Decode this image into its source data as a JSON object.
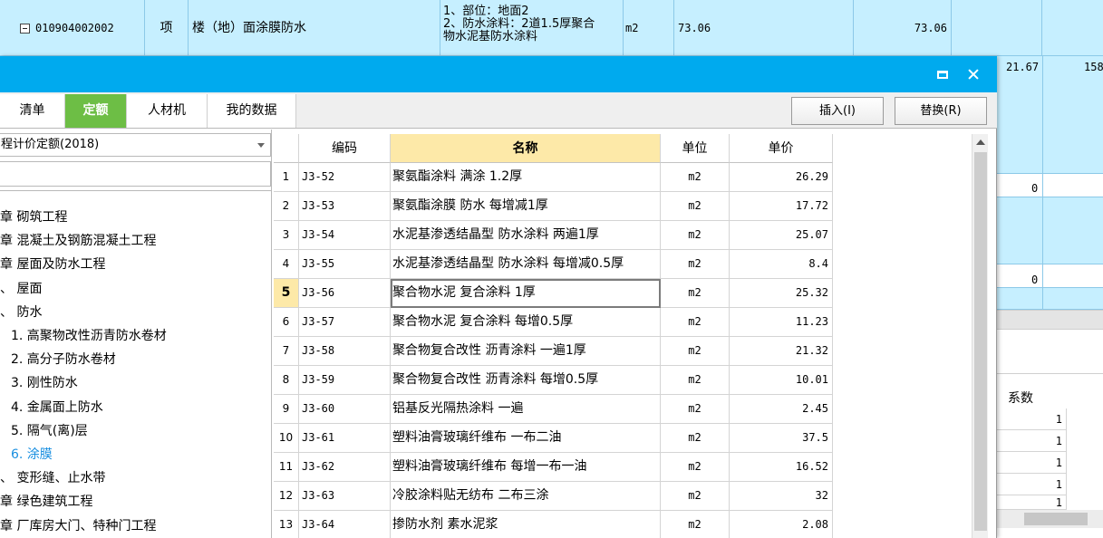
{
  "background_row": {
    "code": "010904002002",
    "type": "项",
    "name": "楼（地）面涂膜防水",
    "features": [
      "1、部位：地面2",
      "2、防水涂料：2道1.5厚聚合",
      "物水泥基防水涂料"
    ],
    "unit": "m2",
    "quantity": "73.06",
    "quantity2": "73.06"
  },
  "background_right": {
    "value_a": "21.67",
    "value_b": "158",
    "zero_1": "0",
    "zero_2": "0",
    "coef_label": "系数",
    "coef_values": [
      "1",
      "1",
      "1",
      "1",
      "1"
    ]
  },
  "dialog": {
    "tabs": [
      {
        "label": "清单",
        "active": false
      },
      {
        "label": "定额",
        "active": true
      },
      {
        "label": "人材机",
        "active": false
      },
      {
        "label": "我的数据",
        "active": false
      }
    ],
    "insert_label": "插入(I)",
    "replace_label": "替换(R)",
    "library": "程计价定额(2018)",
    "search_value": "",
    "tree": [
      {
        "label": "章 砌筑工程",
        "selected": false
      },
      {
        "label": "章 混凝土及钢筋混凝土工程",
        "selected": false
      },
      {
        "label": "章 屋面及防水工程",
        "selected": false
      },
      {
        "label": "、 屋面",
        "selected": false
      },
      {
        "label": "、 防水",
        "selected": false
      },
      {
        "label": "1. 高聚物改性沥青防水卷材",
        "selected": false
      },
      {
        "label": "2. 高分子防水卷材",
        "selected": false
      },
      {
        "label": "3. 刚性防水",
        "selected": false
      },
      {
        "label": "4. 金属面上防水",
        "selected": false
      },
      {
        "label": "5. 隔气(离)层",
        "selected": false
      },
      {
        "label": "6. 涂膜",
        "selected": true
      },
      {
        "label": "、 变形缝、止水带",
        "selected": false
      },
      {
        "label": "章 绿色建筑工程",
        "selected": false
      },
      {
        "label": "章 厂库房大门、特种门工程",
        "selected": false
      }
    ],
    "grid": {
      "headers": {
        "code": "编码",
        "name": "名称",
        "unit": "单位",
        "price": "单价"
      },
      "active_row": 5,
      "rows": [
        {
          "n": "1",
          "code": "J3-52",
          "name": "聚氨酯涂料 满涂 1.2厚",
          "unit": "m2",
          "price": "26.29"
        },
        {
          "n": "2",
          "code": "J3-53",
          "name": "聚氨酯涂膜 防水 每增减1厚",
          "unit": "m2",
          "price": "17.72"
        },
        {
          "n": "3",
          "code": "J3-54",
          "name": "水泥基渗透结晶型 防水涂料 两遍1厚",
          "unit": "m2",
          "price": "25.07"
        },
        {
          "n": "4",
          "code": "J3-55",
          "name": "水泥基渗透结晶型 防水涂料 每增减0.5厚",
          "unit": "m2",
          "price": "8.4"
        },
        {
          "n": "5",
          "code": "J3-56",
          "name": "聚合物水泥 复合涂料 1厚",
          "unit": "m2",
          "price": "25.32"
        },
        {
          "n": "6",
          "code": "J3-57",
          "name": "聚合物水泥 复合涂料 每增0.5厚",
          "unit": "m2",
          "price": "11.23"
        },
        {
          "n": "7",
          "code": "J3-58",
          "name": "聚合物复合改性 沥青涂料 一遍1厚",
          "unit": "m2",
          "price": "21.32"
        },
        {
          "n": "8",
          "code": "J3-59",
          "name": "聚合物复合改性 沥青涂料 每增0.5厚",
          "unit": "m2",
          "price": "10.01"
        },
        {
          "n": "9",
          "code": "J3-60",
          "name": "铝基反光隔热涂料 一遍",
          "unit": "m2",
          "price": "2.45"
        },
        {
          "n": "10",
          "code": "J3-61",
          "name": "塑料油膏玻璃纤维布 一布二油",
          "unit": "m2",
          "price": "37.5"
        },
        {
          "n": "11",
          "code": "J3-62",
          "name": "塑料油膏玻璃纤维布 每增一布一油",
          "unit": "m2",
          "price": "16.52"
        },
        {
          "n": "12",
          "code": "J3-63",
          "name": "冷胶涂料贴无纺布 二布三涂",
          "unit": "m2",
          "price": "32"
        },
        {
          "n": "13",
          "code": "J3-64",
          "name": "掺防水剂 素水泥浆",
          "unit": "m2",
          "price": "2.08"
        }
      ]
    }
  },
  "colors": {
    "titlebar": "#00aaee",
    "active_tab": "#6dbe45",
    "highlight": "#fde9a8",
    "row_bg": "#c6efff",
    "tree_selected": "#1a8fe0"
  },
  "icons": {
    "maximize": "maximize-icon",
    "close": "close-icon",
    "expander": "collapse-minus-icon",
    "dropdown": "chevron-down-icon"
  }
}
